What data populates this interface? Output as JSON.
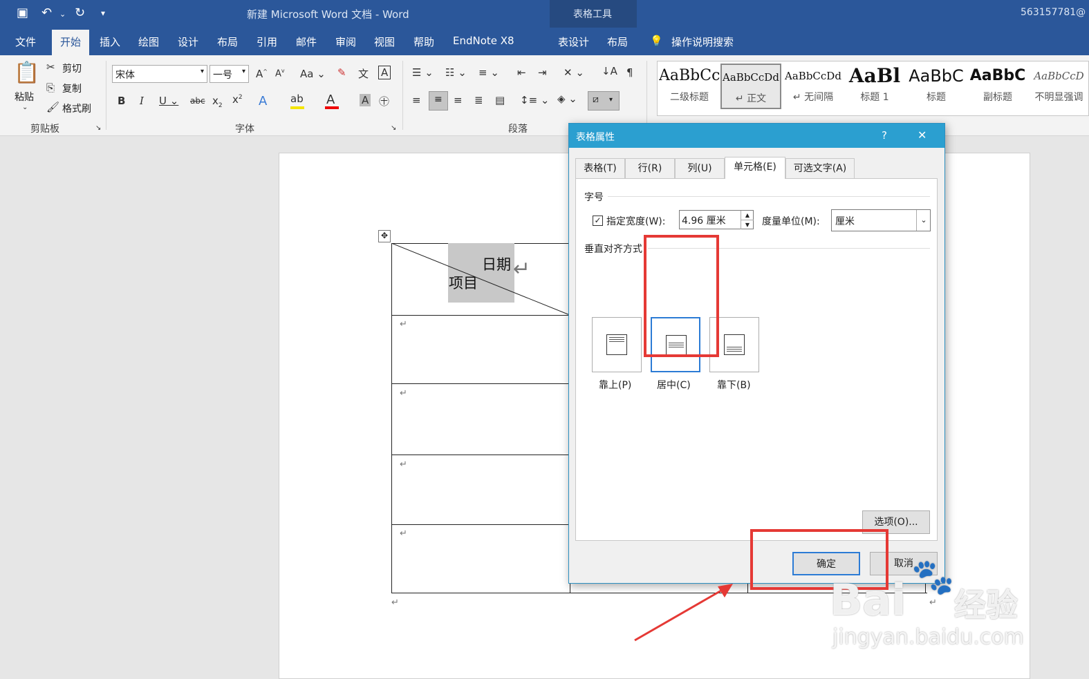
{
  "titlebar": {
    "title": "新建 Microsoft Word 文档 - Word",
    "context_tool": "表格工具",
    "user": "563157781@"
  },
  "tabs": [
    "文件",
    "开始",
    "插入",
    "绘图",
    "设计",
    "布局",
    "引用",
    "邮件",
    "审阅",
    "视图",
    "帮助",
    "EndNote X8",
    "表设计",
    "布局"
  ],
  "tell_me": "操作说明搜索",
  "clipboard": {
    "paste": "粘贴",
    "cut": "剪切",
    "copy": "复制",
    "format_painter": "格式刷",
    "label": "剪贴板"
  },
  "font": {
    "name": "宋体",
    "size": "一号",
    "label": "字体"
  },
  "paragraph": {
    "label": "段落"
  },
  "styles": [
    {
      "sample": "AaBbCc",
      "name": "二级标题"
    },
    {
      "sample": "AaBbCcDd",
      "name": "↵ 正文"
    },
    {
      "sample": "AaBbCcDd",
      "name": "↵ 无间隔"
    },
    {
      "sample": "AaBl",
      "name": "标题 1"
    },
    {
      "sample": "AaBbC",
      "name": "标题"
    },
    {
      "sample": "AaBbC",
      "name": "副标题"
    },
    {
      "sample": "AaBbCcD",
      "name": "不明显强调"
    }
  ],
  "document": {
    "cell_date": "日期",
    "cell_item": "项目",
    "para_mark": "↵"
  },
  "dialog": {
    "title": "表格属性",
    "help": "?",
    "close": "✕",
    "tabs": [
      "表格(T)",
      "行(R)",
      "列(U)",
      "单元格(E)",
      "可选文字(A)"
    ],
    "section_size": "字号",
    "width_checkbox": "指定宽度(W):",
    "width_value": "4.96 厘米",
    "unit_label": "度量单位(M):",
    "unit_value": "厘米",
    "section_valign": "垂直对齐方式",
    "align_top": "靠上(P)",
    "align_center": "居中(C)",
    "align_bottom": "靠下(B)",
    "options_button": "选项(O)...",
    "ok_button": "确定",
    "cancel_button": "取消"
  },
  "watermark": {
    "brand": "Bai",
    "jy": "经验",
    "url": "jingyan.baidu.com"
  },
  "colors": {
    "title_blue": "#2b579a",
    "dialog_title": "#2b9fd0",
    "highlight_red": "#e53935"
  }
}
